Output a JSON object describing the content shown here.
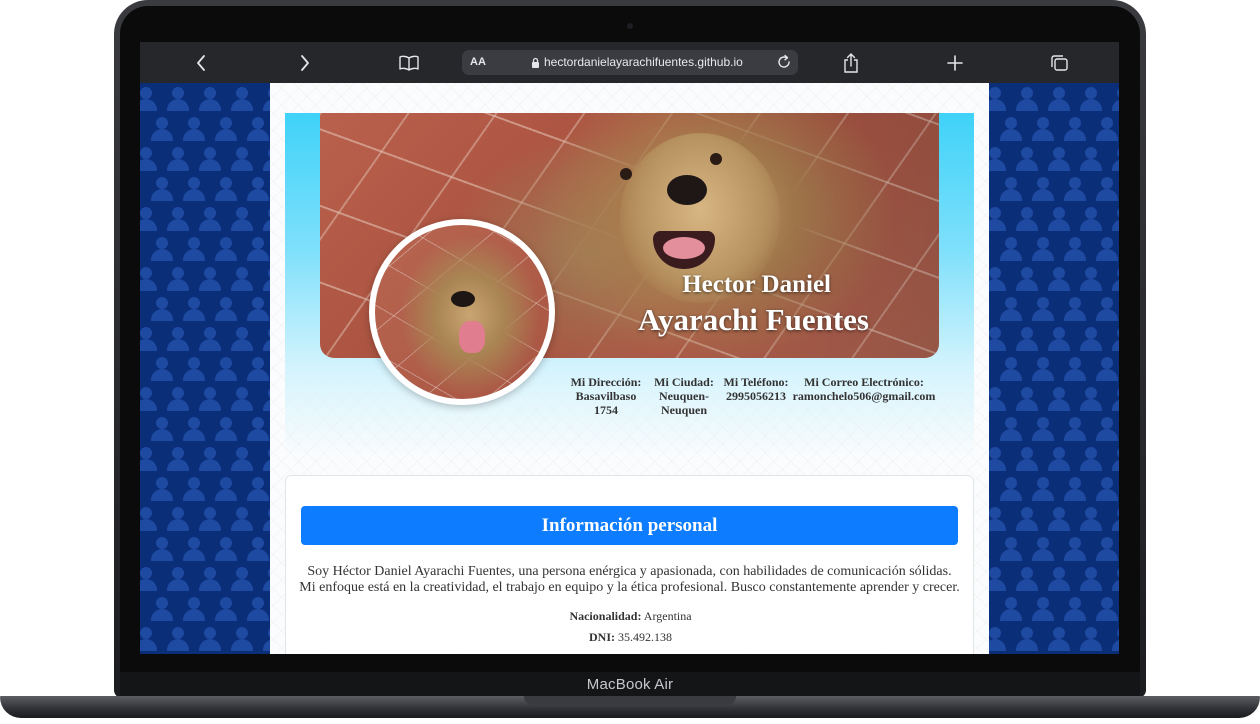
{
  "device": {
    "label": "MacBook Air"
  },
  "browser": {
    "text_size_label": "AA",
    "url": "hectordanielayarachifuentes.github.io"
  },
  "profile": {
    "first_names": "Hector Daniel",
    "last_names": "Ayarachi Fuentes",
    "contact": [
      {
        "label": "Mi Dirección:",
        "value": "Basavilbaso 1754"
      },
      {
        "label": "Mi Ciudad:",
        "value": "Neuquen-Neuquen"
      },
      {
        "label": "Mi Teléfono:",
        "value": "2995056213"
      },
      {
        "label": "Mi Correo Electrónico:",
        "value": "ramonchelo506@gmail.com"
      }
    ]
  },
  "personal_info": {
    "heading": "Información personal",
    "bio": "Soy Héctor Daniel Ayarachi Fuentes, una persona enérgica y apasionada, con habilidades de comunicación sólidas. Mi enfoque está en la creatividad, el trabajo en equipo y la ética profesional. Busco constantemente aprender y crecer.",
    "nationality_label": "Nacionalidad:",
    "nationality_value": "Argentina",
    "dni_label": "DNI:",
    "dni_value": "35.492.138"
  },
  "colors": {
    "page_background": "#0a2e77",
    "header_gradient_top": "#3fd2f8",
    "section_header": "#0d7cfe"
  }
}
